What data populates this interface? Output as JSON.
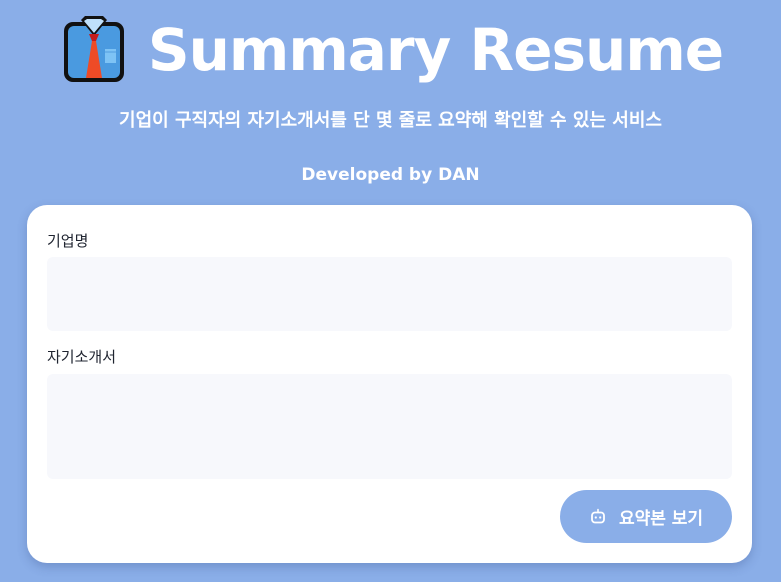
{
  "header": {
    "logo_icon": "shirt-tie-icon",
    "title": "Summary Resume",
    "subtitle": "기업이 구직자의 자기소개서를 단 몇 줄로 요약해 확인할 수 있는 서비스",
    "developer": "Developed by DAN"
  },
  "form": {
    "company_label": "기업명",
    "company_value": "",
    "resume_label": "자기소개서",
    "resume_value": "",
    "submit_icon": "robot-icon",
    "submit_label": "요약본 보기"
  },
  "colors": {
    "background": "#8aaee8",
    "card": "#ffffff",
    "input_background": "#f7f8fc",
    "button": "#8aaee8",
    "text_dark": "#1f2430"
  }
}
